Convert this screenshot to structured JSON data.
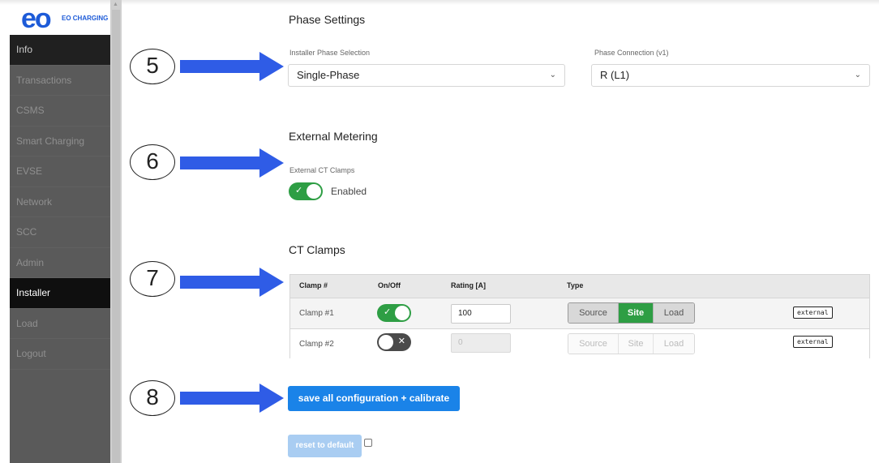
{
  "brand": {
    "logo_mark": "eo",
    "logo_text": "EO CHARGING"
  },
  "sidebar": {
    "items": [
      {
        "label": "Info",
        "state": "active"
      },
      {
        "label": "Transactions"
      },
      {
        "label": "CSMS"
      },
      {
        "label": "Smart Charging"
      },
      {
        "label": "EVSE"
      },
      {
        "label": "Network"
      },
      {
        "label": "SCC"
      },
      {
        "label": "Admin"
      },
      {
        "label": "Installer",
        "state": "current"
      },
      {
        "label": "Load"
      },
      {
        "label": "Logout"
      }
    ]
  },
  "phase": {
    "heading": "Phase Settings",
    "installer_label": "Installer Phase Selection",
    "installer_value": "Single-Phase",
    "connection_label": "Phase Connection (v1)",
    "connection_value": "R (L1)"
  },
  "metering": {
    "heading": "External Metering",
    "clamps_label": "External CT Clamps",
    "toggle_state": "on",
    "toggle_text": "Enabled"
  },
  "ct_clamps": {
    "heading": "CT Clamps",
    "columns": [
      "Clamp #",
      "On/Off",
      "Rating [A]",
      "Type"
    ],
    "rows": [
      {
        "name": "Clamp #1",
        "on": true,
        "rating": "100",
        "type_options": [
          "Source",
          "Site",
          "Load"
        ],
        "selected_type": "Site",
        "tag": "external"
      },
      {
        "name": "Clamp #2",
        "on": false,
        "rating": "0",
        "type_options": [
          "Source",
          "Site",
          "Load"
        ],
        "selected_type": "",
        "tag": "external"
      }
    ]
  },
  "actions": {
    "save_label": "save all configuration + calibrate",
    "reset_label": "reset to default"
  },
  "annotations": {
    "steps": [
      "5",
      "6",
      "7",
      "8"
    ],
    "arrow_color": "#2f5ce6"
  },
  "icons": {
    "select_chevron": "chevron-down-icon",
    "toggle_check": "check-icon",
    "toggle_x": "close-icon"
  },
  "colors": {
    "accent": "#1a83e8",
    "success": "#2e9e44",
    "sidebar_bg": "#5a5a5a"
  }
}
